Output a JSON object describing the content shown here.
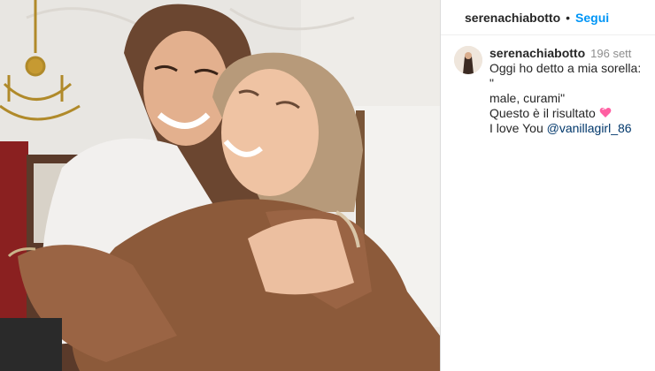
{
  "post": {
    "username": "serenachiabotto",
    "follow_label": "Segui",
    "separator": "•",
    "photo_alt": ""
  },
  "caption": {
    "username": "serenachiabotto",
    "time": "196 sett",
    "line1": "Oggi ho detto a mia sorella: \"",
    "line2": "male, curami\"",
    "line3": "Questo è il risultato",
    "line3_emoji": "heart-emoji",
    "line4_prefix": "I love You ",
    "mention": "@vanillagirl_86"
  },
  "colors": {
    "accent": "#0095f6",
    "mention": "#00376b",
    "heart": "#ff5fa2"
  }
}
